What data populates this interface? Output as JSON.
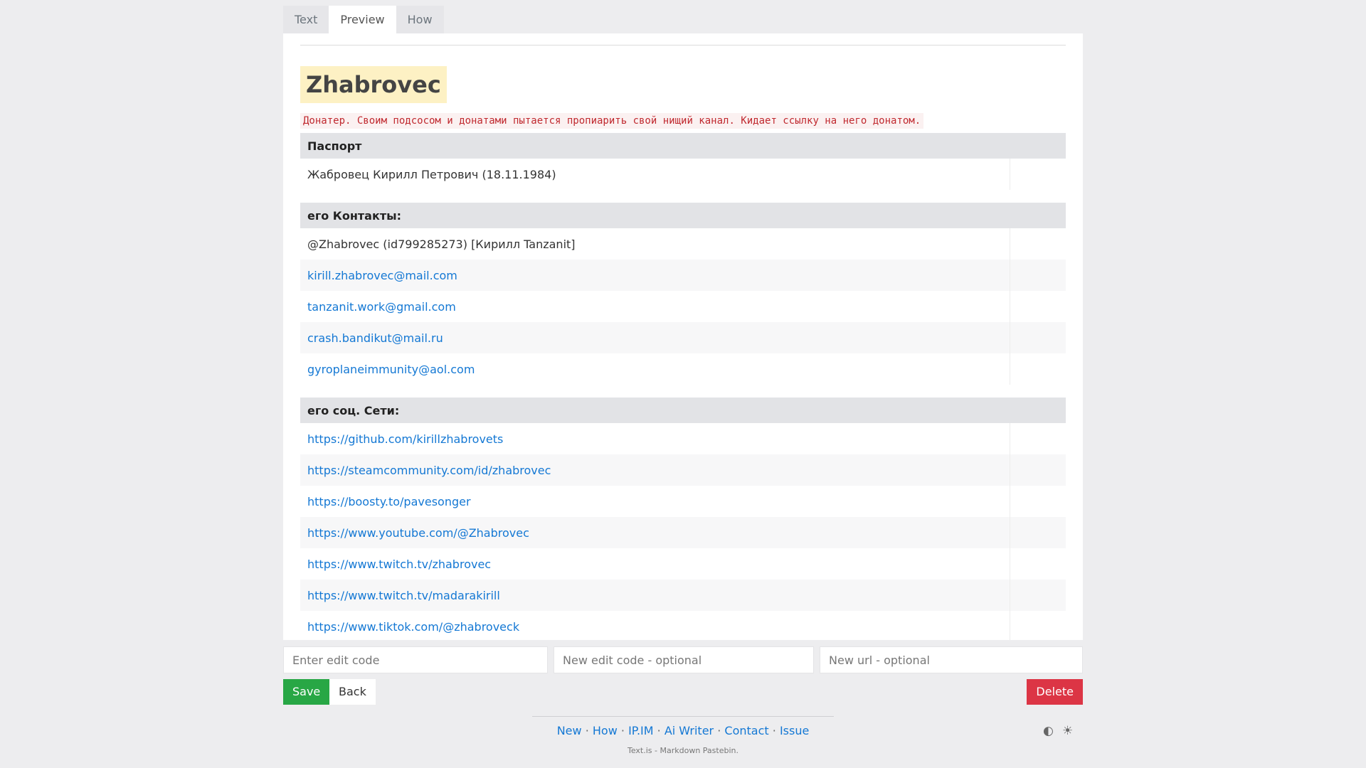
{
  "tabs": [
    "Text",
    "Preview",
    "How"
  ],
  "title": "Zhabrovec",
  "note": "Донатер. Своим подсосом и донатами пытается пропиарить свой нищий канал. Кидает ссылку на него донатом.",
  "passport": {
    "header": "Паспорт",
    "rows": [
      "Жабровец Кирилл Петрович (18.11.1984)"
    ]
  },
  "contacts": {
    "header": "его Контакты:",
    "rows": [
      "@Zhabrovec (id799285273) [Кирилл Tanzanit]",
      "kirill.zhabrovec@mail.com",
      "tanzanit.work@gmail.com",
      "crash.bandikut@mail.ru",
      "gyroplaneimmunity@aol.com"
    ]
  },
  "social": {
    "header": "его соц. Сети:",
    "rows": [
      "https://github.com/kirillzhabrovets",
      "https://steamcommunity.com/id/zhabrovec",
      "https://boosty.to/pavesonger",
      "https://www.youtube.com/@Zhabrovec",
      "https://www.twitch.tv/zhabrovec",
      "https://www.twitch.tv/madarakirill",
      "https://www.tiktok.com/@zhabroveck"
    ]
  },
  "inputs": {
    "edit_code": "Enter edit code",
    "new_edit_code": "New edit code - optional",
    "new_url": "New url - optional"
  },
  "buttons": {
    "save": "Save",
    "back": "Back",
    "delete": "Delete"
  },
  "footer": {
    "links": [
      "New",
      "How",
      "IP.IM",
      "Ai Writer",
      "Contact",
      "Issue"
    ],
    "separator": "·",
    "tagline": "Text.is - Markdown Pastebin.",
    "theme_icons": [
      "◐",
      "☀"
    ]
  },
  "colors": {
    "save": "#28a745",
    "delete": "#dc3545",
    "link": "#1478d4",
    "highlight": "#fdf1c4"
  }
}
